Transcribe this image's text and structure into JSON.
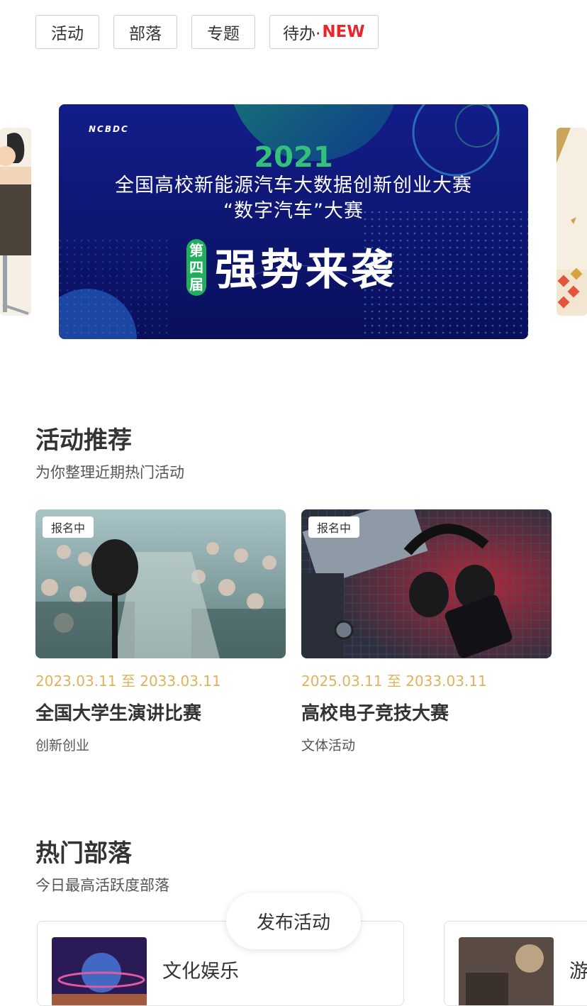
{
  "tabs": [
    {
      "label": "活动"
    },
    {
      "label": "部落"
    },
    {
      "label": "专题"
    },
    {
      "label": "待办·",
      "new_label": "NEW"
    }
  ],
  "banner": {
    "logo_text": "NCBDC",
    "year": "2021",
    "line1": "全国高校新能源汽车大数据创新创业大赛",
    "line2": "“数字汽车”大赛",
    "edition": "第四届",
    "slogan": "强势来袭"
  },
  "activities": {
    "title": "活动推荐",
    "subtitle": "为你整理近期热门活动",
    "cards": [
      {
        "badge": "报名中",
        "date": "2023.03.11 至 2033.03.11",
        "title": "全国大学生演讲比赛",
        "category": "创新创业"
      },
      {
        "badge": "报名中",
        "date": "2025.03.11 至 2033.03.11",
        "title": "高校电子竞技大赛",
        "category": "文体活动"
      }
    ]
  },
  "tribes": {
    "title": "热门部落",
    "subtitle": "今日最高活跃度部落",
    "items": [
      {
        "name": "文化娱乐"
      },
      {
        "name": "游"
      }
    ]
  },
  "fab": {
    "label": "发布活动"
  }
}
